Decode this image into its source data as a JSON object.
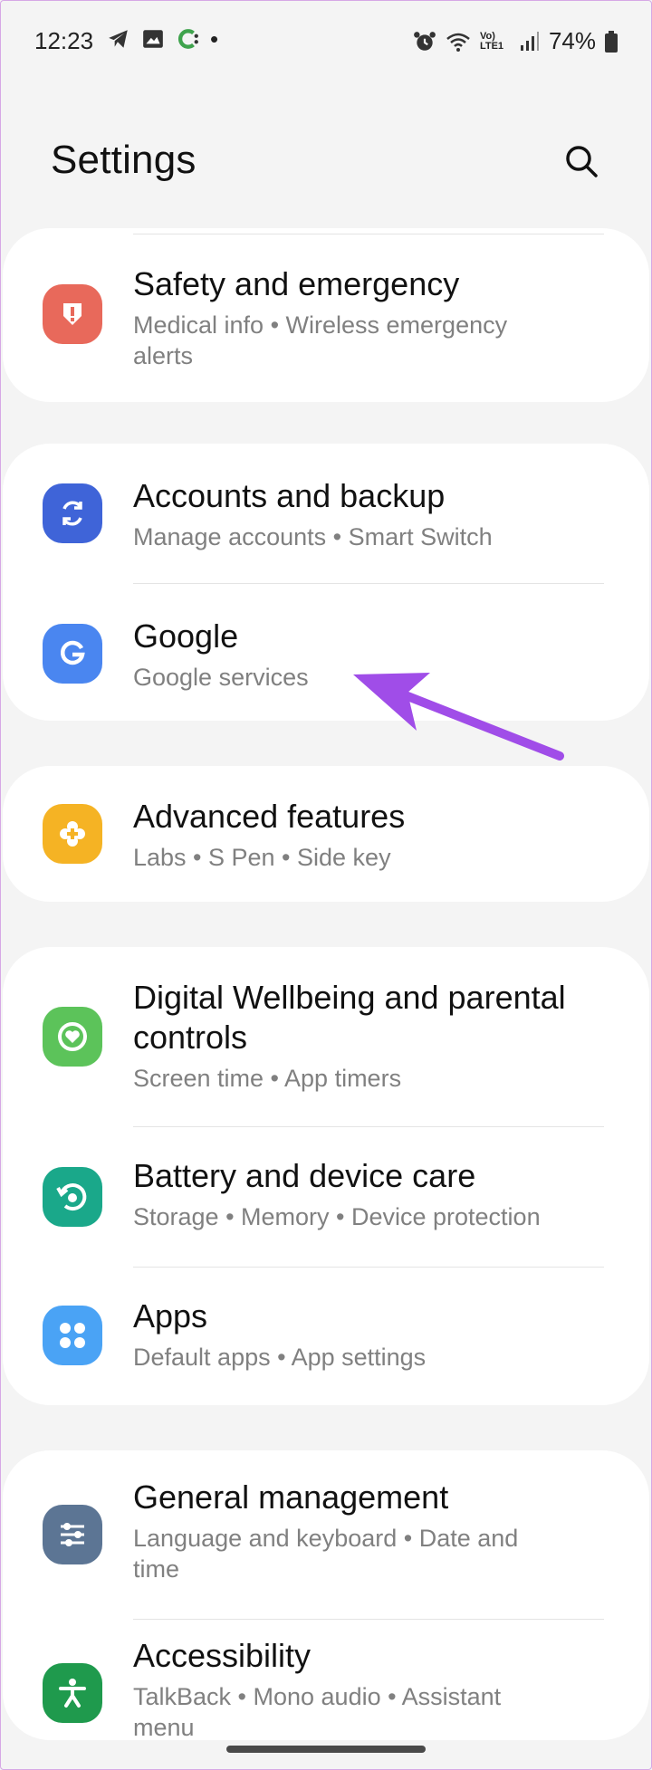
{
  "status_bar": {
    "time": "12:23",
    "battery": "74%",
    "network_label": "Vo) LTE1"
  },
  "header": {
    "title": "Settings"
  },
  "items": [
    {
      "title": "Safety and emergency",
      "subtitle_line1": "Medical info  •  Wireless emergency",
      "subtitle_line2": "alerts",
      "icon": "alert-icon",
      "color": "#e8695b"
    },
    {
      "title": "Accounts and backup",
      "subtitle_line1": "Manage accounts  •  Smart Switch",
      "icon": "sync-icon",
      "color": "#3f64d8"
    },
    {
      "title": "Google",
      "subtitle_line1": "Google services",
      "icon": "google-icon",
      "color": "#4a86f0"
    },
    {
      "title": "Advanced features",
      "subtitle_line1": "Labs  •  S Pen  •  Side key",
      "icon": "plus-gear-icon",
      "color": "#f5b324"
    },
    {
      "title_line1": "Digital Wellbeing and parental",
      "title_line2": "controls",
      "subtitle_line1": "Screen time  •  App timers",
      "icon": "heart-circle-icon",
      "color": "#5cc35a"
    },
    {
      "title": "Battery and device care",
      "subtitle_line1": "Storage  •  Memory  •  Device protection",
      "icon": "refresh-circle-icon",
      "color": "#1aa88a"
    },
    {
      "title": "Apps",
      "subtitle_line1": "Default apps  •  App settings",
      "icon": "apps-grid-icon",
      "color": "#4aa3f5"
    },
    {
      "title": "General management",
      "subtitle_line1": "Language and keyboard  •  Date and",
      "subtitle_line2": "time",
      "icon": "sliders-icon",
      "color": "#5c7594"
    },
    {
      "title": "Accessibility",
      "subtitle_line1": "TalkBack  •  Mono audio  •  Assistant",
      "subtitle_line2": "menu",
      "icon": "accessibility-icon",
      "color": "#1f9a4d"
    }
  ],
  "annotation": {
    "arrow_color": "#a04de8"
  }
}
